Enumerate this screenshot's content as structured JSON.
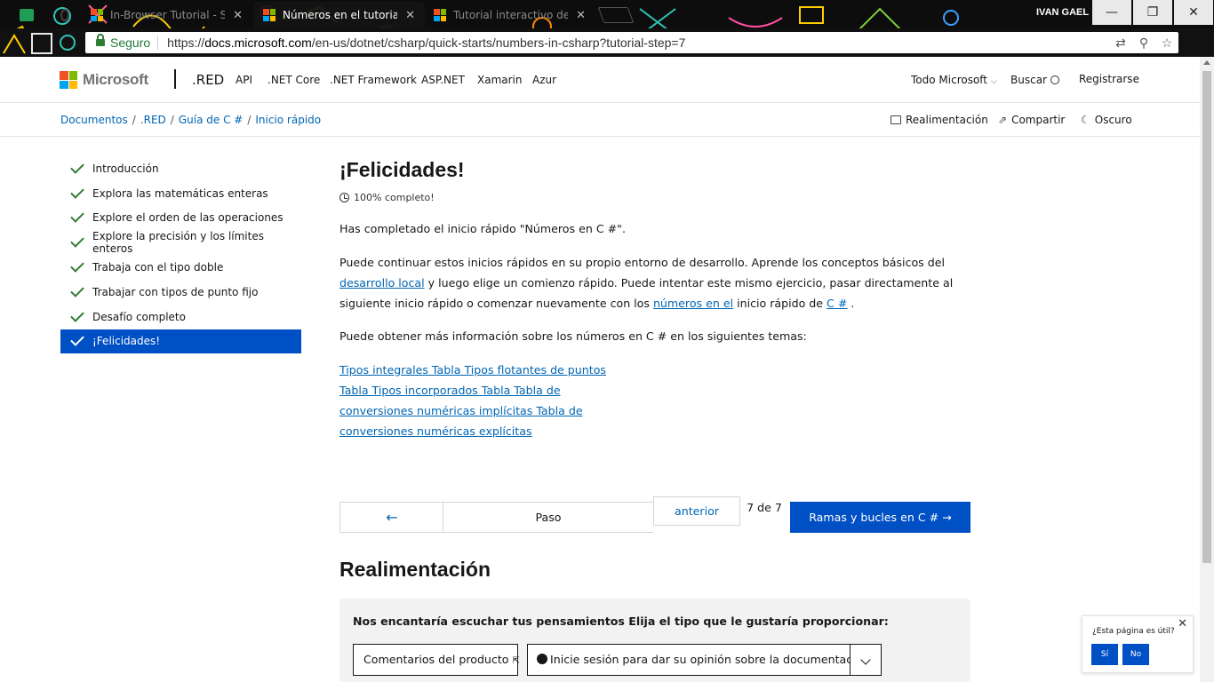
{
  "browser": {
    "tabs": [
      {
        "title": "In-Browser Tutorial - Step",
        "active": false
      },
      {
        "title": "Números en el tutorial",
        "active": true
      },
      {
        "title": "Tutorial interactivo de ra",
        "active": false
      }
    ],
    "user": "IVAN GAEL",
    "secure_label": "Seguro",
    "url_scheme": "https://",
    "url_domain": "docs.microsoft.com",
    "url_path": "/en-us/dotnet/csharp/quick-starts/numbers-in-csharp?tutorial-step=7",
    "window_buttons": {
      "minimize": "—",
      "restore": "❐",
      "close": "✕"
    }
  },
  "header": {
    "logo_text": "Microsoft",
    "brand": ".RED",
    "nav": [
      "API",
      ".NET Core",
      ".NET Framework",
      "ASP.NET",
      "Xamarin",
      "Azur"
    ],
    "all_microsoft": "Todo Microsoft",
    "search": "Buscar",
    "signin": "Registrarse"
  },
  "breadcrumb": {
    "items": [
      "Documentos",
      ".RED",
      "Guía de C #",
      "Inicio rápido"
    ],
    "actions": {
      "feedback": "Realimentación",
      "share": "Compartir",
      "theme": "Oscuro"
    }
  },
  "sidebar": {
    "items": [
      {
        "label": "Introducción",
        "active": false
      },
      {
        "label": "Explora las matemáticas enteras",
        "active": false
      },
      {
        "label": "Explore el orden de las operaciones",
        "active": false
      },
      {
        "label": "Explore la precisión y los límites enteros",
        "active": false
      },
      {
        "label": "Trabaja con el tipo doble",
        "active": false
      },
      {
        "label": "Trabajar con tipos de punto fijo",
        "active": false
      },
      {
        "label": "Desafío completo",
        "active": false
      },
      {
        "label": "¡Felicidades!",
        "active": true
      }
    ]
  },
  "main": {
    "title": "¡Felicidades!",
    "progress": "100% completo!",
    "progress_value": 1.0,
    "p1": "Has completado el inicio rápido \"Números en C #\".",
    "p2": {
      "a": "Puede continuar estos inicios rápidos en su propio entorno de desarrollo. Aprende los conceptos básicos del ",
      "link1": "desarrollo local",
      "b": " y luego elige un comienzo rápido. Puede intentar este mismo ejercicio, pasar directamente al siguiente inicio rápido o comenzar nuevamente con los ",
      "link2": "números en el",
      "c": " inicio rápido de ",
      "link3": "C #",
      "d": " ."
    },
    "p3": "Puede obtener más información sobre los números en C # en los siguientes temas:",
    "topic_links": "Tipos integrales Tabla Tipos flotantes de puntos Tabla Tipos incorporados Tabla Tabla de conversiones numéricas implícitas Tabla de conversiones numéricas explícitas"
  },
  "pager": {
    "prev_arrow": "←",
    "step_label": "Paso",
    "previous_label": "anterior",
    "count": "7 de 7",
    "next_label": "Ramas y bucles en C #",
    "next_arrow": "→"
  },
  "feedback": {
    "heading": "Realimentación",
    "question": "Nos encantaría escuchar tus pensamientos Elija el tipo que le gustaría proporcionar:",
    "product_button": "Comentarios del producto",
    "docs_button": "Inicie sesión para dar su opinión sobre la documentación",
    "dropdown_icon": "chevron-down-icon"
  },
  "helpful": {
    "question": "¿Esta página es útil?",
    "yes": "Sí",
    "no": "No"
  },
  "colors": {
    "accent": "#0050c5",
    "link": "#0065b3",
    "check": "#2e7d32"
  }
}
